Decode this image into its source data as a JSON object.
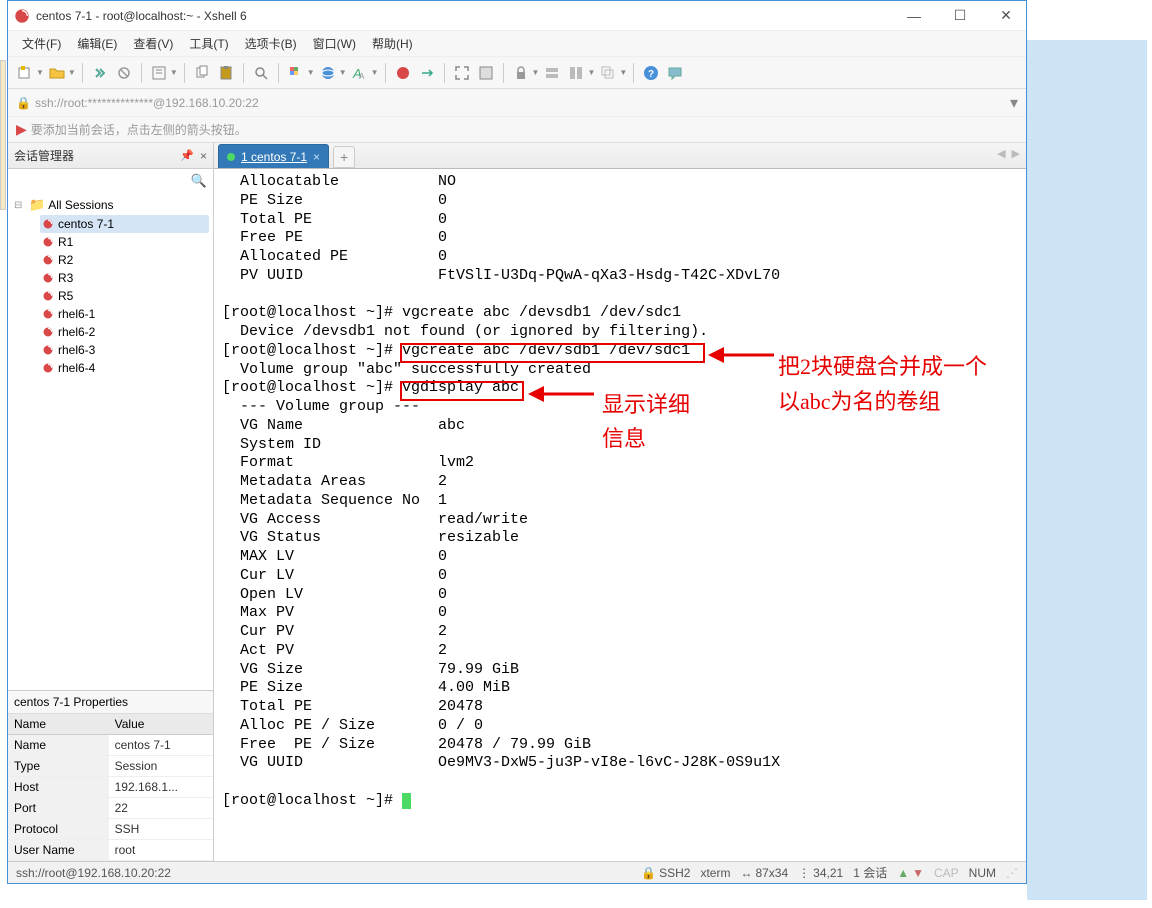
{
  "window": {
    "title": "centos 7-1 - root@localhost:~ - Xshell 6"
  },
  "menubar": {
    "items": [
      "文件(F)",
      "编辑(E)",
      "查看(V)",
      "工具(T)",
      "选项卡(B)",
      "窗口(W)",
      "帮助(H)"
    ]
  },
  "addressbar": {
    "text": "ssh://root:**************@192.168.10.20:22"
  },
  "infobar": {
    "text": "要添加当前会话，点击左侧的箭头按钮。"
  },
  "sidebar": {
    "title": "会话管理器",
    "root": "All Sessions",
    "sessions": [
      {
        "name": "centos 7-1",
        "selected": true
      },
      {
        "name": "R1"
      },
      {
        "name": "R2"
      },
      {
        "name": "R3"
      },
      {
        "name": "R5"
      },
      {
        "name": "rhel6-1"
      },
      {
        "name": "rhel6-2"
      },
      {
        "name": "rhel6-3"
      },
      {
        "name": "rhel6-4"
      }
    ]
  },
  "properties": {
    "title": "centos 7-1 Properties",
    "head_name": "Name",
    "head_value": "Value",
    "rows": [
      {
        "k": "Name",
        "v": "centos 7-1"
      },
      {
        "k": "Type",
        "v": "Session"
      },
      {
        "k": "Host",
        "v": "192.168.1..."
      },
      {
        "k": "Port",
        "v": "22"
      },
      {
        "k": "Protocol",
        "v": "SSH"
      },
      {
        "k": "User Name",
        "v": "root"
      }
    ]
  },
  "tabs": {
    "active": "1 centos 7-1"
  },
  "terminal": {
    "lines": [
      "  Allocatable           NO",
      "  PE Size               0",
      "  Total PE              0",
      "  Free PE               0",
      "  Allocated PE          0",
      "  PV UUID               FtVSlI-U3Dq-PQwA-qXa3-Hsdg-T42C-XDvL70",
      "",
      "[root@localhost ~]# vgcreate abc /devsdb1 /dev/sdc1",
      "  Device /devsdb1 not found (or ignored by filtering).",
      "[root@localhost ~]# vgcreate abc /dev/sdb1 /dev/sdc1",
      "  Volume group \"abc\" successfully created",
      "[root@localhost ~]# vgdisplay abc",
      "  --- Volume group ---",
      "  VG Name               abc",
      "  System ID",
      "  Format                lvm2",
      "  Metadata Areas        2",
      "  Metadata Sequence No  1",
      "  VG Access             read/write",
      "  VG Status             resizable",
      "  MAX LV                0",
      "  Cur LV                0",
      "  Open LV               0",
      "  Max PV                0",
      "  Cur PV                2",
      "  Act PV                2",
      "  VG Size               79.99 GiB",
      "  PE Size               4.00 MiB",
      "  Total PE              20478",
      "  Alloc PE / Size       0 / 0",
      "  Free  PE / Size       20478 / 79.99 GiB",
      "  VG UUID               Oe9MV3-DxW5-ju3P-vI8e-l6vC-J28K-0S9u1X",
      "",
      "[root@localhost ~]# "
    ]
  },
  "annotations": {
    "a1": "把2块硬盘合并成一个",
    "a2": "以abc为名的卷组",
    "a3": "显示详细",
    "a4": "信息"
  },
  "statusbar": {
    "conn": "ssh://root@192.168.10.20:22",
    "proto": "SSH2",
    "term": "xterm",
    "size": "87x34",
    "pos": "34,21",
    "sess": "1 会话",
    "cap": "CAP",
    "num": "NUM"
  }
}
